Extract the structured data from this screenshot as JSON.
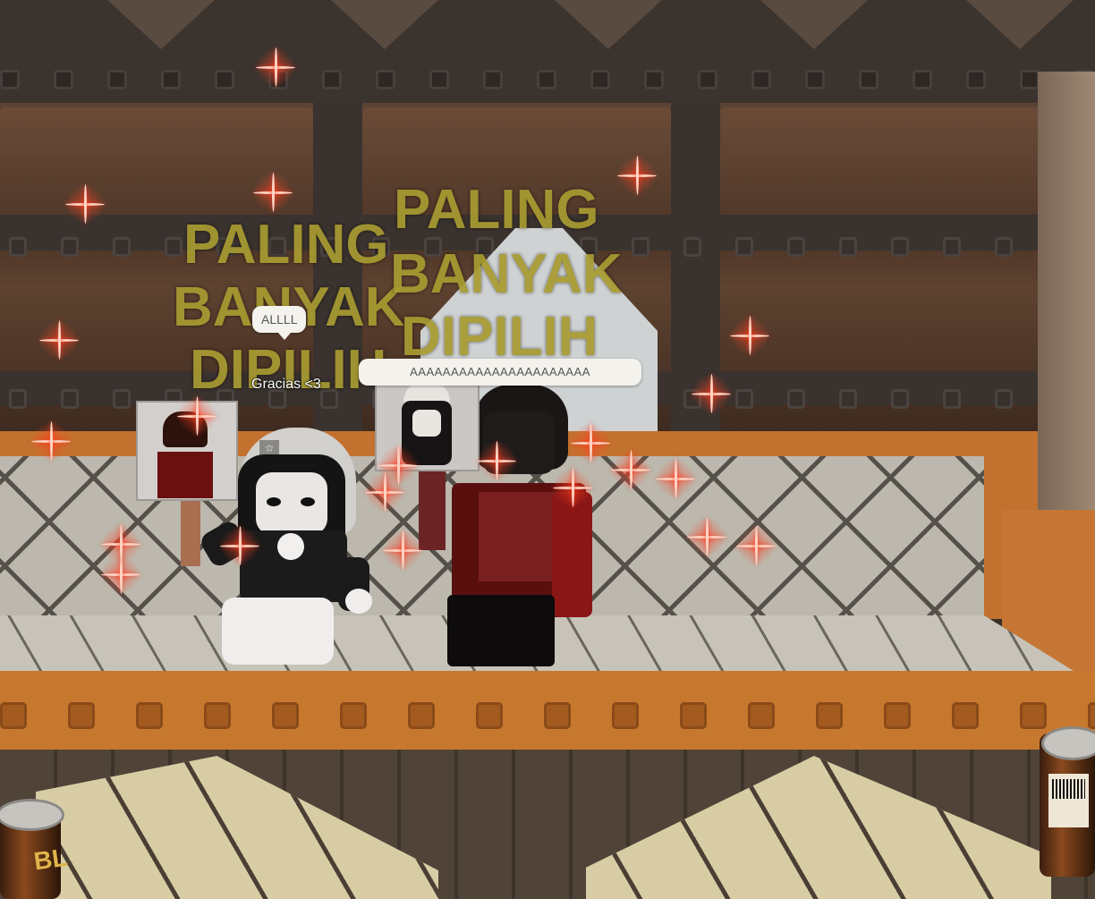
{
  "billboards": [
    {
      "lines": [
        "PALING",
        "BANYAK",
        "DIPILIH"
      ]
    },
    {
      "lines": [
        "PALING",
        "BANYAK",
        "DIPILIH"
      ]
    }
  ],
  "chat": {
    "bubble_left": "ALLLL",
    "bubble_right": "AAAAAAAAAAAAAAAAAAAAAA"
  },
  "name_tag": "Gracias <3",
  "can_label": "BL",
  "colors": {
    "billboard_text": "#a89b31",
    "sofa_orange": "#c7782f",
    "sparkle": "#ff3b1e"
  }
}
